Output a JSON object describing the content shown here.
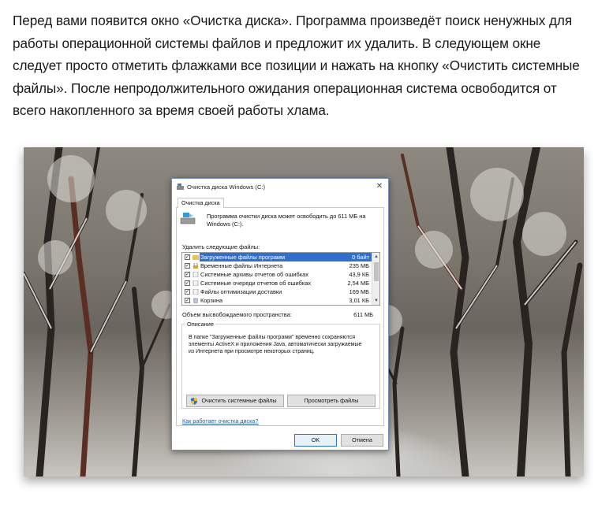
{
  "article": {
    "paragraph": "Перед вами появится окно «Очистка диска». Программа произведёт поиск ненужных для работы операционной системы файлов и предложит их удалить. В следующем окне следует просто отметить флажками все позиции и нажать на кнопку «Очистить системные файлы». После непродолжительного ожидания операционная система освободится от всего накопленного за время своей работы хлама."
  },
  "dialog": {
    "title": "Очистка диска Windows (C:)",
    "close_glyph": "✕",
    "tab_label": "Очистка диска",
    "summary": "Программа очистки диска может освободить до 611 МБ на Windows (C:).",
    "files_label": "Удалить следующие файлы:",
    "files": [
      {
        "name": "Загруженные файлы программ",
        "size": "0 байт",
        "checked": true,
        "selected": true
      },
      {
        "name": "Временные файлы Интернета",
        "size": "235 МБ",
        "checked": true,
        "selected": false
      },
      {
        "name": "Системные архивы отчетов об ошибках",
        "size": "43,9 КБ",
        "checked": true,
        "selected": false
      },
      {
        "name": "Системные очереди отчетов об ошибках",
        "size": "2,54 МБ",
        "checked": true,
        "selected": false
      },
      {
        "name": "Файлы оптимизации доставки",
        "size": "169 МБ",
        "checked": true,
        "selected": false
      },
      {
        "name": "Корзина",
        "size": "3,01 КБ",
        "checked": true,
        "selected": false
      }
    ],
    "check_glyph": "✓",
    "scroll_up_glyph": "▲",
    "scroll_down_glyph": "▼",
    "total_label": "Объем высвобождаемого пространства:",
    "total_value": "611 МБ",
    "description_legend": "Описание",
    "description_text": "В папке \"Загруженные файлы программ\" временно сохраняются элементы ActiveX и приложения Java, автоматически загружаемые из Интернета при просмотре некоторых страниц.",
    "clean_system_button": "Очистить системные файлы",
    "view_files_button": "Просмотреть файлы",
    "help_link": "Как работает очистка диска?",
    "ok_button": "OK",
    "cancel_button": "Отмена"
  },
  "colors": {
    "selection": "#2f6fd1",
    "link": "#1a5fb4",
    "ok_border": "#2a73d1"
  }
}
